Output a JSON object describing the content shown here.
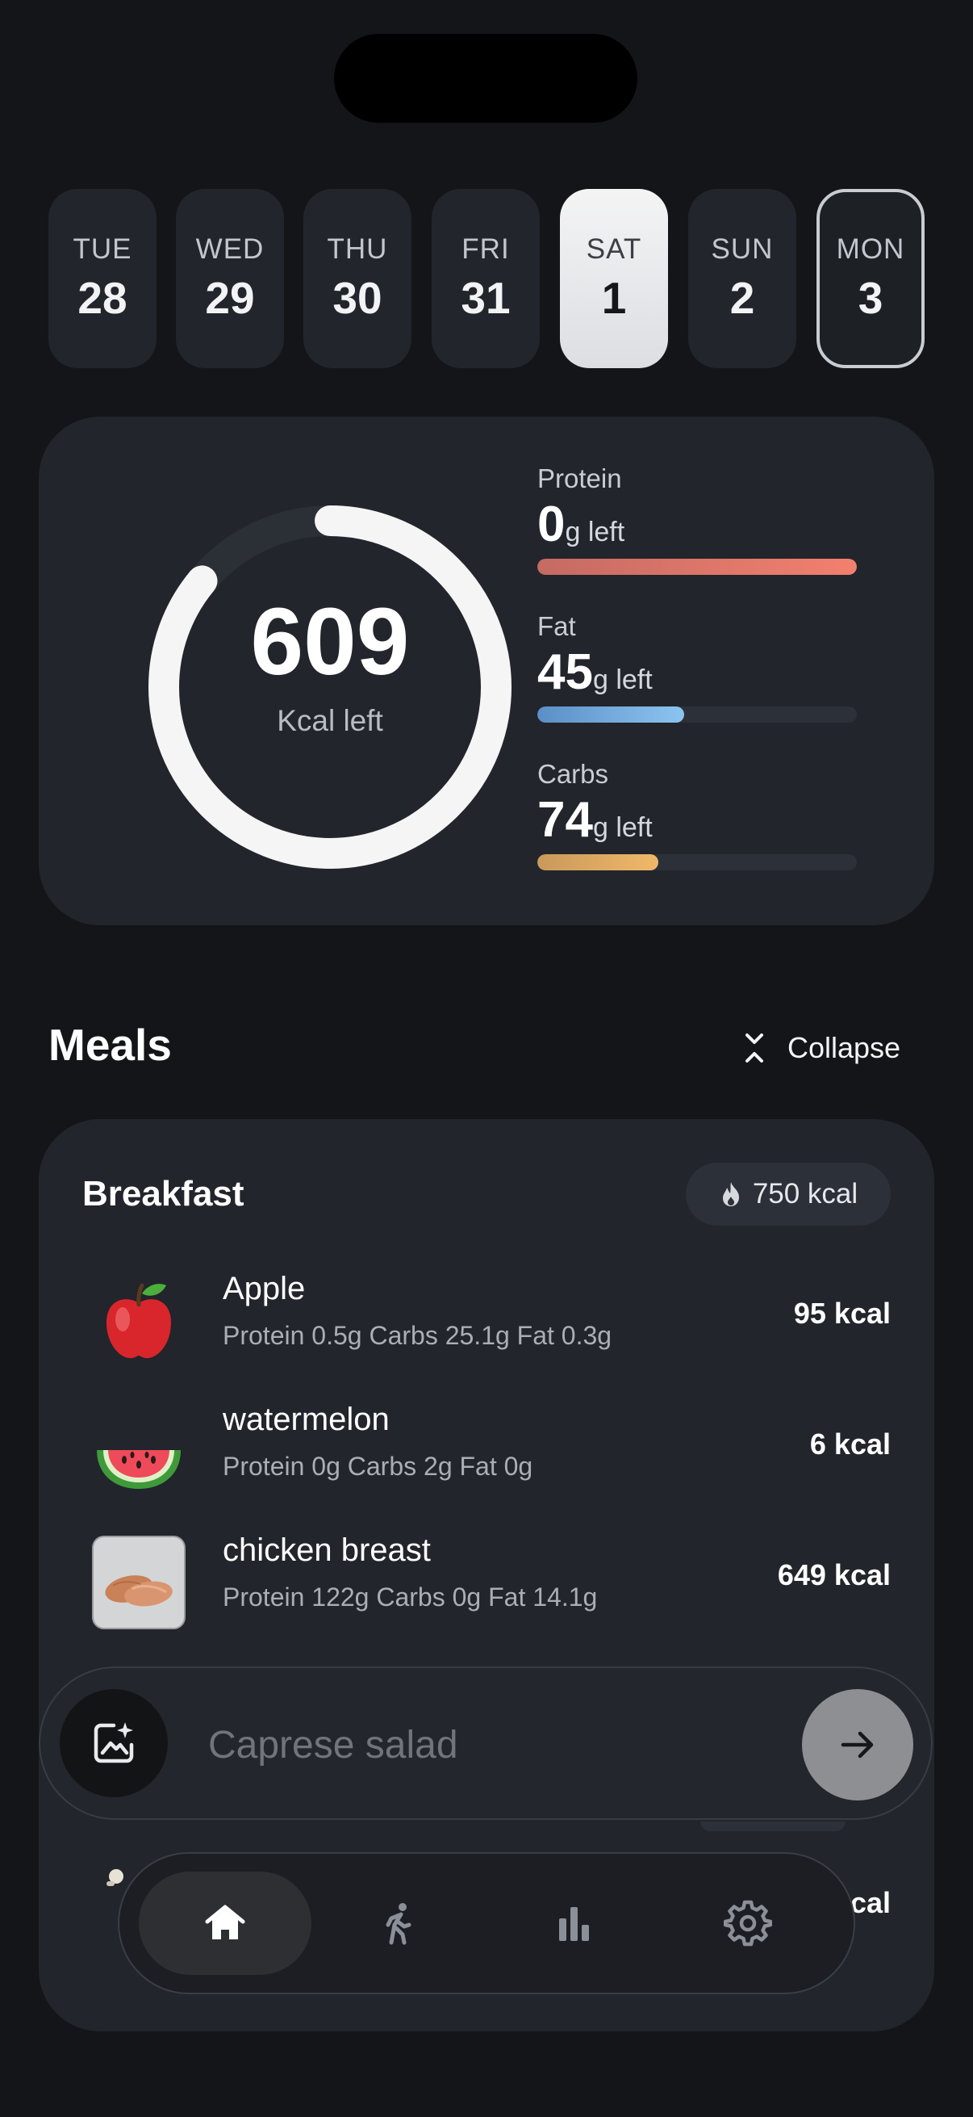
{
  "days": [
    {
      "dow": "TUE",
      "num": "28"
    },
    {
      "dow": "WED",
      "num": "29"
    },
    {
      "dow": "THU",
      "num": "30"
    },
    {
      "dow": "FRI",
      "num": "31"
    },
    {
      "dow": "SAT",
      "num": "1",
      "state": "selected"
    },
    {
      "dow": "SUN",
      "num": "2"
    },
    {
      "dow": "MON",
      "num": "3",
      "state": "today"
    }
  ],
  "summary": {
    "kcal_left": "609",
    "kcal_label": "Kcal left",
    "ring_progress": 0.86,
    "macros": [
      {
        "label": "Protein",
        "value": "0",
        "unit": "g left",
        "fill": 1.0,
        "color_from": "#c56b63",
        "color_to": "#f2806f"
      },
      {
        "label": "Fat",
        "value": "45",
        "unit": "g left",
        "fill": 0.46,
        "color_from": "#5b8fc7",
        "color_to": "#8cc4f0"
      },
      {
        "label": "Carbs",
        "value": "74",
        "unit": "g left",
        "fill": 0.38,
        "color_from": "#c9995a",
        "color_to": "#f0b869"
      }
    ]
  },
  "meals_header": {
    "title": "Meals",
    "collapse_label": "Collapse"
  },
  "meal": {
    "name": "Breakfast",
    "kcal_badge": "750 kcal",
    "items": [
      {
        "name": "Apple",
        "macros": "Protein 0.5g  Carbs 25.1g  Fat 0.3g",
        "kcal": "95 kcal",
        "icon": "apple"
      },
      {
        "name": "watermelon",
        "macros": "Protein 0g  Carbs 2g  Fat 0g",
        "kcal": "6 kcal",
        "icon": "watermelon"
      },
      {
        "name": "chicken breast",
        "macros": "Protein 122g  Carbs 0g  Fat 14.1g",
        "kcal": "649 kcal",
        "icon": "chicken-photo"
      }
    ]
  },
  "search": {
    "placeholder": "Caprese salad"
  },
  "peek": {
    "kcal_fragment": "cal"
  },
  "nav": {
    "tabs": [
      {
        "icon": "home-icon",
        "active": true
      },
      {
        "icon": "walking-icon",
        "active": false
      },
      {
        "icon": "bar-chart-icon",
        "active": false
      },
      {
        "icon": "gear-icon",
        "active": false
      }
    ]
  }
}
